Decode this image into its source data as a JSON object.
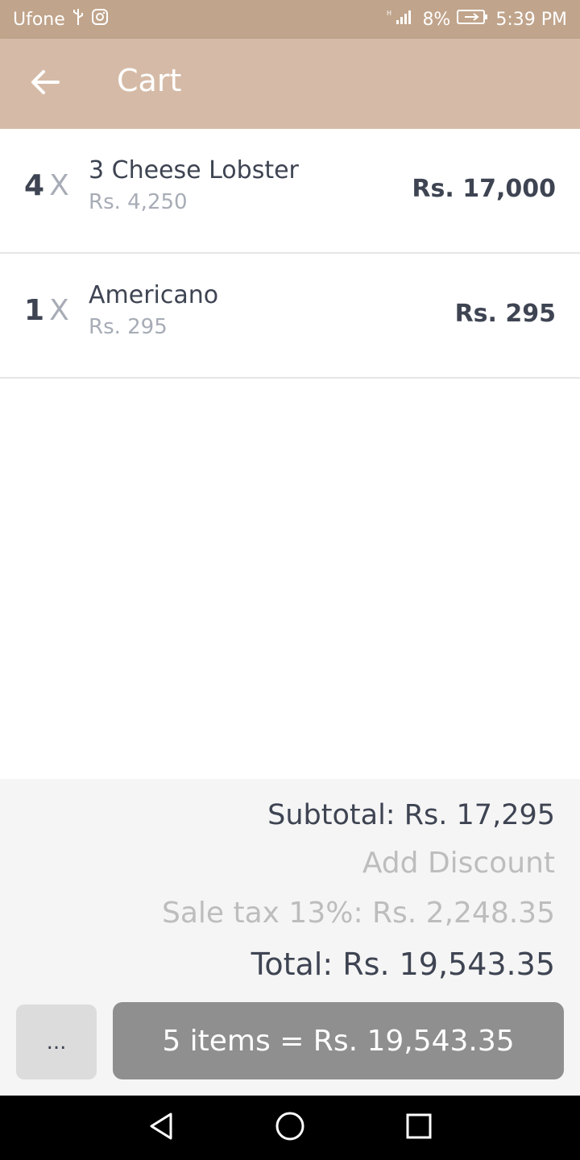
{
  "status_bar": {
    "carrier": "Ufone",
    "battery": "8%",
    "time": "5:39 PM",
    "icons": [
      "usb-icon",
      "instagram-icon",
      "signal-icon",
      "battery-charging-icon"
    ]
  },
  "app_bar": {
    "title": "Cart",
    "back_icon": "arrow-left-icon"
  },
  "cart": {
    "items": [
      {
        "qty": "4",
        "x": "X",
        "name": "3 Cheese Lobster",
        "unit_price": "Rs. 4,250",
        "line_total": "Rs. 17,000"
      },
      {
        "qty": "1",
        "x": "X",
        "name": "Americano",
        "unit_price": "Rs. 295",
        "line_total": "Rs. 295"
      }
    ]
  },
  "summary": {
    "subtotal": "Subtotal: Rs. 17,295",
    "add_discount": "Add Discount",
    "sale_tax": "Sale tax 13%: Rs. 2,248.35",
    "total": "Total: Rs. 19,543.35"
  },
  "actions": {
    "more_label": "...",
    "checkout_label": "5 items = Rs. 19,543.35"
  },
  "nav_bar": {
    "icons": [
      "back-triangle-icon",
      "home-circle-icon",
      "recents-square-icon"
    ]
  },
  "colors": {
    "status_bar": "#c0a48b",
    "app_bar": "#d5bba7",
    "text_dark": "#3e4452",
    "text_muted": "#a7acb6",
    "checkout_button": "#8f8f8f"
  }
}
